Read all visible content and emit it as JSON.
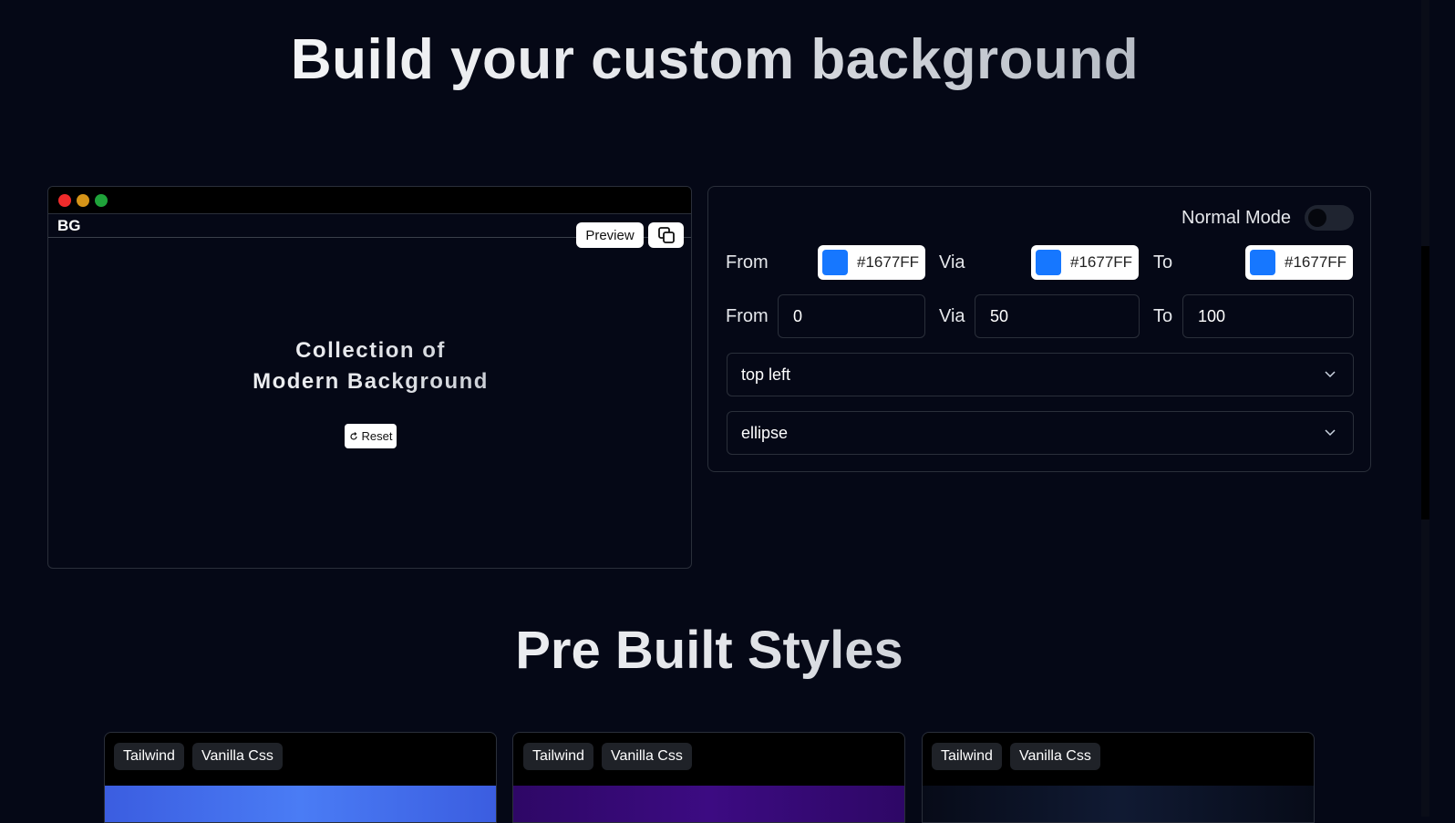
{
  "hero": {
    "title": "Build your custom background"
  },
  "preview": {
    "brand": "BG",
    "preview_label": "Preview",
    "title_line1": "Collection of",
    "title_line2": "Modern Background",
    "reset_label": "Reset"
  },
  "controls": {
    "mode_label": "Normal Mode",
    "mode_enabled": false,
    "colors": [
      {
        "label": "From",
        "hex": "#1677FF"
      },
      {
        "label": "Via",
        "hex": "#1677FF"
      },
      {
        "label": "To",
        "hex": "#1677FF"
      }
    ],
    "stops": [
      {
        "label": "From",
        "value": "0"
      },
      {
        "label": "Via",
        "value": "50"
      },
      {
        "label": "To",
        "value": "100"
      }
    ],
    "position_select": "top left",
    "shape_select": "ellipse"
  },
  "prebuilt": {
    "title": "Pre Built Styles",
    "cards": [
      {
        "tag1": "Tailwind",
        "tag2": "Vanilla Css",
        "accent": "#3b63e6"
      },
      {
        "tag1": "Tailwind",
        "tag2": "Vanilla Css",
        "accent": "#3b0a7a"
      },
      {
        "tag1": "Tailwind",
        "tag2": "Vanilla Css",
        "accent": "#0a0f20"
      }
    ]
  }
}
